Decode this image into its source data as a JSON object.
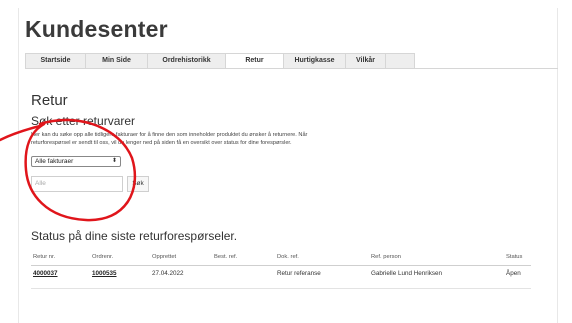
{
  "header": {
    "title": "Kundesenter"
  },
  "tabs": [
    {
      "label": "Startside",
      "active": false
    },
    {
      "label": "Min Side",
      "active": false
    },
    {
      "label": "Ordrehistorikk",
      "active": false
    },
    {
      "label": "Retur",
      "active": true
    },
    {
      "label": "Hurtigkasse",
      "active": false
    },
    {
      "label": "Vilkår",
      "active": false
    },
    {
      "label": "",
      "active": false
    }
  ],
  "page": {
    "heading": "Retur",
    "search_heading": "Søk etter returvarer",
    "intro_line1": "Her kan du søke opp alle tidligere fakturaer for å finne den som inneholder produktet du ønsker å returnere. Når",
    "intro_line2": "returforespørsel er sendt til oss, vil du lenger ned på siden få en oversikt over status for dine forespørsler."
  },
  "filter": {
    "select_value": "Alle fakturaer",
    "search_placeholder": "Alle",
    "search_button": "Søk"
  },
  "status": {
    "heading": "Status på dine siste returforespørseler.",
    "columns": [
      "Retur nr.",
      "Ordrenr.",
      "Opprettet",
      "Best. ref.",
      "Dok. ref.",
      "Ref. person",
      "Status"
    ],
    "rows": [
      {
        "retur_nr": "4000037",
        "ordre_nr": "1000535",
        "opprettet": "27.04.2022",
        "best_ref": "",
        "dok_ref": "Retur referanse",
        "ref_person": "Gabrielle Lund Henriksen",
        "status": "Åpen"
      }
    ]
  },
  "colors": {
    "annotation_red": "#e0151b",
    "tab_bg": "#eeeeee",
    "border": "#d6d6d6"
  }
}
